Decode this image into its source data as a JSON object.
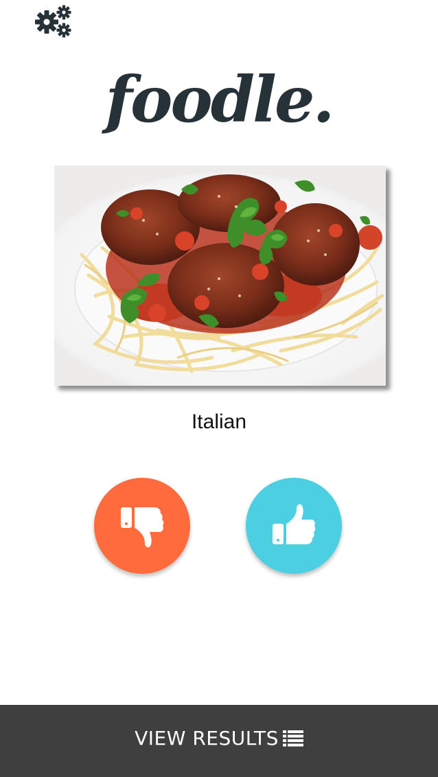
{
  "app": {
    "logo_text": "foodle."
  },
  "settings": {
    "icon": "gears-icon"
  },
  "card": {
    "image_alt": "spaghetti-with-meatballs",
    "cuisine": "Italian"
  },
  "actions": {
    "dislike": {
      "icon": "thumbs-down-icon",
      "color": "#ff6b3d"
    },
    "like": {
      "icon": "thumbs-up-icon",
      "color": "#4ccfe0"
    }
  },
  "footer": {
    "label": "VIEW RESULTS",
    "icon": "list-icon",
    "color": "#3f3f3f"
  }
}
